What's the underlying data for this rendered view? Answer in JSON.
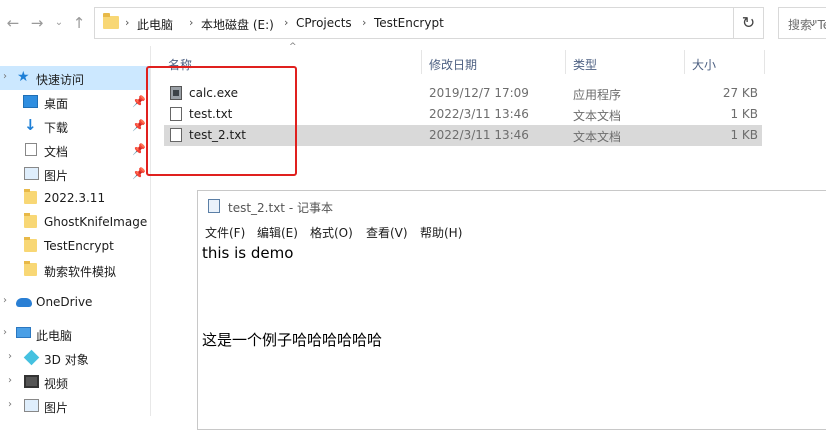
{
  "address_bar": {
    "breadcrumbs": [
      "此电脑",
      "本地磁盘 (E:)",
      "CProjects",
      "TestEncrypt"
    ],
    "search_placeholder": "搜索\"Te"
  },
  "sidebar": {
    "items": [
      {
        "label": "快速访问",
        "icon": "star-icon"
      },
      {
        "label": "桌面",
        "icon": "desktop-icon",
        "pinned": true
      },
      {
        "label": "下载",
        "icon": "download-icon",
        "pinned": true
      },
      {
        "label": "文档",
        "icon": "document-icon",
        "pinned": true
      },
      {
        "label": "图片",
        "icon": "pictures-icon",
        "pinned": true
      },
      {
        "label": "2022.3.11",
        "icon": "folder-icon"
      },
      {
        "label": "GhostKnifeImage",
        "icon": "folder-icon"
      },
      {
        "label": "TestEncrypt",
        "icon": "folder-icon"
      },
      {
        "label": "勒索软件模拟",
        "icon": "folder-icon"
      },
      {
        "label": "OneDrive",
        "icon": "cloud-icon"
      },
      {
        "label": "此电脑",
        "icon": "computer-icon"
      },
      {
        "label": "3D 对象",
        "icon": "3d-objects-icon"
      },
      {
        "label": "视频",
        "icon": "video-icon"
      },
      {
        "label": "图片",
        "icon": "pictures-icon"
      }
    ]
  },
  "file_list": {
    "columns": [
      "名称",
      "修改日期",
      "类型",
      "大小"
    ],
    "rows": [
      {
        "name": "calc.exe",
        "date": "2019/12/7 17:09",
        "type": "应用程序",
        "size": "27 KB"
      },
      {
        "name": "test.txt",
        "date": "2022/3/11 13:46",
        "type": "文本文档",
        "size": "1 KB"
      },
      {
        "name": "test_2.txt",
        "date": "2022/3/11 13:46",
        "type": "文本文档",
        "size": "1 KB"
      }
    ]
  },
  "notepad": {
    "title": "test_2.txt - 记事本",
    "menu": [
      "文件(F)",
      "编辑(E)",
      "格式(O)",
      "查看(V)",
      "帮助(H)"
    ],
    "lines": [
      "this is demo",
      "这是一个例子哈哈哈哈哈哈"
    ]
  }
}
